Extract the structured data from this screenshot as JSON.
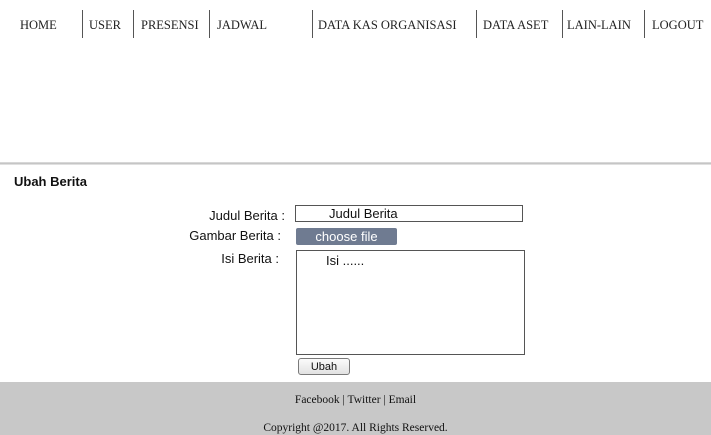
{
  "nav": {
    "items": [
      {
        "label": "HOME"
      },
      {
        "label": "USER"
      },
      {
        "label": "PRESENSI"
      },
      {
        "label": "JADWAL"
      },
      {
        "label": "DATA KAS ORGANISASI"
      },
      {
        "label": "DATA ASET"
      },
      {
        "label": "LAIN-LAIN"
      },
      {
        "label": "LOGOUT"
      }
    ]
  },
  "form": {
    "title": "Ubah Berita",
    "judul_label": "Judul Berita :",
    "judul_value": "Judul Berita",
    "gambar_label": "Gambar Berita :",
    "file_button": "choose file",
    "isi_label": "Isi Berita :",
    "isi_value": "Isi ......",
    "submit_label": "Ubah"
  },
  "footer": {
    "facebook": "Facebook",
    "twitter": "Twitter",
    "email": "Email",
    "separator": " | ",
    "copyright": "Copyright @2017. All Rights Reserved."
  },
  "colors": {
    "file_button_bg": "#6f7b91",
    "footer_bg": "#c8c8c8"
  }
}
